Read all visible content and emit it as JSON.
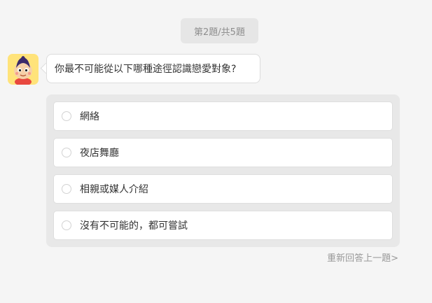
{
  "progress": {
    "label": "第2題/共5題",
    "current": 2,
    "total": 5
  },
  "question": {
    "text": "你最不可能從以下哪種途徑認識戀愛對象?"
  },
  "options": [
    {
      "label": "網絡"
    },
    {
      "label": "夜店舞廳"
    },
    {
      "label": "相親或媒人介紹"
    },
    {
      "label": "沒有不可能的，都可嘗試"
    }
  ],
  "actions": {
    "redo_label": "重新回答上一題>"
  },
  "colors": {
    "background": "#f5f5f5",
    "panel": "#e8e8e8",
    "avatar_bg": "#ffe37a"
  },
  "icons": {
    "avatar": "cartoon-boy-avatar",
    "radio": "radio-unchecked"
  }
}
